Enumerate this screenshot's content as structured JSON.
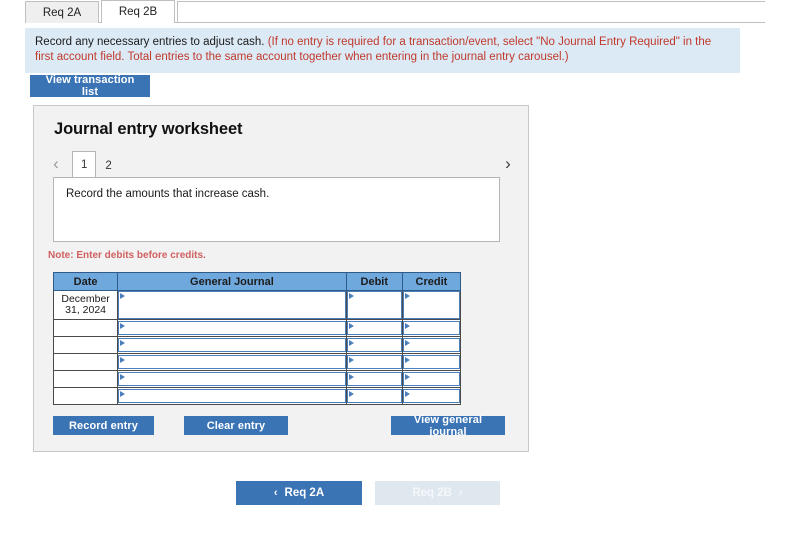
{
  "tabs": [
    {
      "label": "Req 2A",
      "active": false
    },
    {
      "label": "Req 2B",
      "active": true
    }
  ],
  "banner": {
    "main_text": "Record any necessary entries to adjust cash.",
    "hint_text": "(If no entry is required for a transaction/event, select \"No Journal Entry Required\" in the first account field. Total entries to the same account together when entering in the journal entry carousel.)"
  },
  "toolbar": {
    "view_transaction_list_label": "View transaction list"
  },
  "panel": {
    "title": "Journal entry worksheet",
    "carousel": {
      "prev_icon": "chevron-left-icon",
      "next_icon": "chevron-right-icon",
      "prev_glyph": "‹",
      "next_glyph": "›",
      "pages": [
        {
          "label": "1",
          "active": true
        },
        {
          "label": "2",
          "active": false
        }
      ]
    },
    "prompt": "Record the amounts that increase cash.",
    "note": "Note: Enter debits before credits."
  },
  "journal_table": {
    "headers": [
      "Date",
      "General Journal",
      "Debit",
      "Credit"
    ],
    "rows": [
      {
        "date": "December\n31, 2024",
        "general_journal": "",
        "debit": "",
        "credit": "",
        "tall": true
      },
      {
        "date": "",
        "general_journal": "",
        "debit": "",
        "credit": "",
        "tall": false
      },
      {
        "date": "",
        "general_journal": "",
        "debit": "",
        "credit": "",
        "tall": false
      },
      {
        "date": "",
        "general_journal": "",
        "debit": "",
        "credit": "",
        "tall": false
      },
      {
        "date": "",
        "general_journal": "",
        "debit": "",
        "credit": "",
        "tall": false
      },
      {
        "date": "",
        "general_journal": "",
        "debit": "",
        "credit": "",
        "tall": false
      }
    ]
  },
  "actions": {
    "record_entry_label": "Record entry",
    "clear_entry_label": "Clear entry",
    "view_general_journal_label": "View general journal"
  },
  "pager": {
    "prev_label": "Req 2A",
    "next_label": "Req 2B",
    "prev_glyph": "‹",
    "next_glyph": "›",
    "next_disabled": true
  },
  "colors": {
    "accent_blue": "#3b74b5",
    "table_header_blue": "#6fa8dc",
    "banner_blue": "#dceaf6",
    "panel_gray": "#f2f2f2",
    "note_red": "#d06060",
    "hint_red": "#c0392b",
    "disabled_gray": "#dfe7ef"
  }
}
